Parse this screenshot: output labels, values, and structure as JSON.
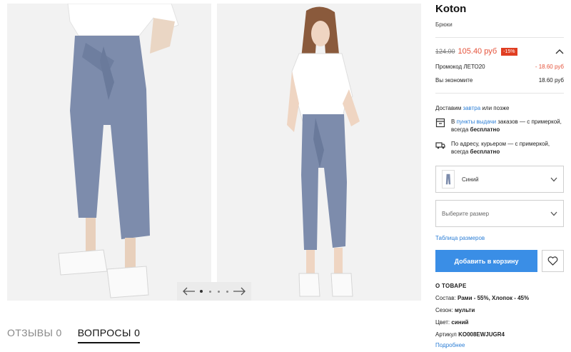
{
  "product": {
    "brand": "Koton",
    "type": "Брюки"
  },
  "price": {
    "old": "124.00",
    "new": "105.40 руб",
    "discount": "-15%"
  },
  "promo": {
    "label": "Промокод ЛЕТО20",
    "value": "- 18.60 руб"
  },
  "savings": {
    "label": "Вы экономите",
    "value": "18.60 руб"
  },
  "delivery": {
    "prefix": "Доставим",
    "day": "завтра",
    "suffix": "или позже",
    "pickup": {
      "pre": "В",
      "link": "пункты выдачи",
      "text": "заказов — с примеркой, всегда",
      "bold": "бесплатно"
    },
    "courier": {
      "text": "По адресу, курьером — с примеркой, всегда",
      "bold": "бесплатно"
    }
  },
  "color_select": {
    "value": "Синий"
  },
  "size_select": {
    "placeholder": "Выберите размер"
  },
  "size_table": "Таблица размеров",
  "add_to_cart": "Добавить в корзину",
  "about": {
    "title": "О ТОВАРЕ",
    "composition_label": "Состав:",
    "composition_value": "Рами - 55%, Хлопок - 45%",
    "season_label": "Сезон:",
    "season_value": "мульти",
    "color_label": "Цвет:",
    "color_value": "синий",
    "article_label": "Артикул",
    "article_value": "KO008EWJUGR4",
    "more": "Подробнее"
  },
  "tabs": [
    {
      "label": "ОТЗЫВЫ 0"
    },
    {
      "label": "ВОПРОСЫ 0"
    }
  ],
  "colors": {
    "accent": "#3a8ee6",
    "sale": "#e5533b",
    "link": "#2d7fd6"
  },
  "icons": {
    "prev": "arrow-left-icon",
    "next": "arrow-right-icon",
    "collapse": "chevron-up-icon",
    "pickup": "pickup-point-icon",
    "courier": "courier-truck-icon",
    "dropdown": "chevron-down-icon",
    "favorite": "heart-icon"
  }
}
